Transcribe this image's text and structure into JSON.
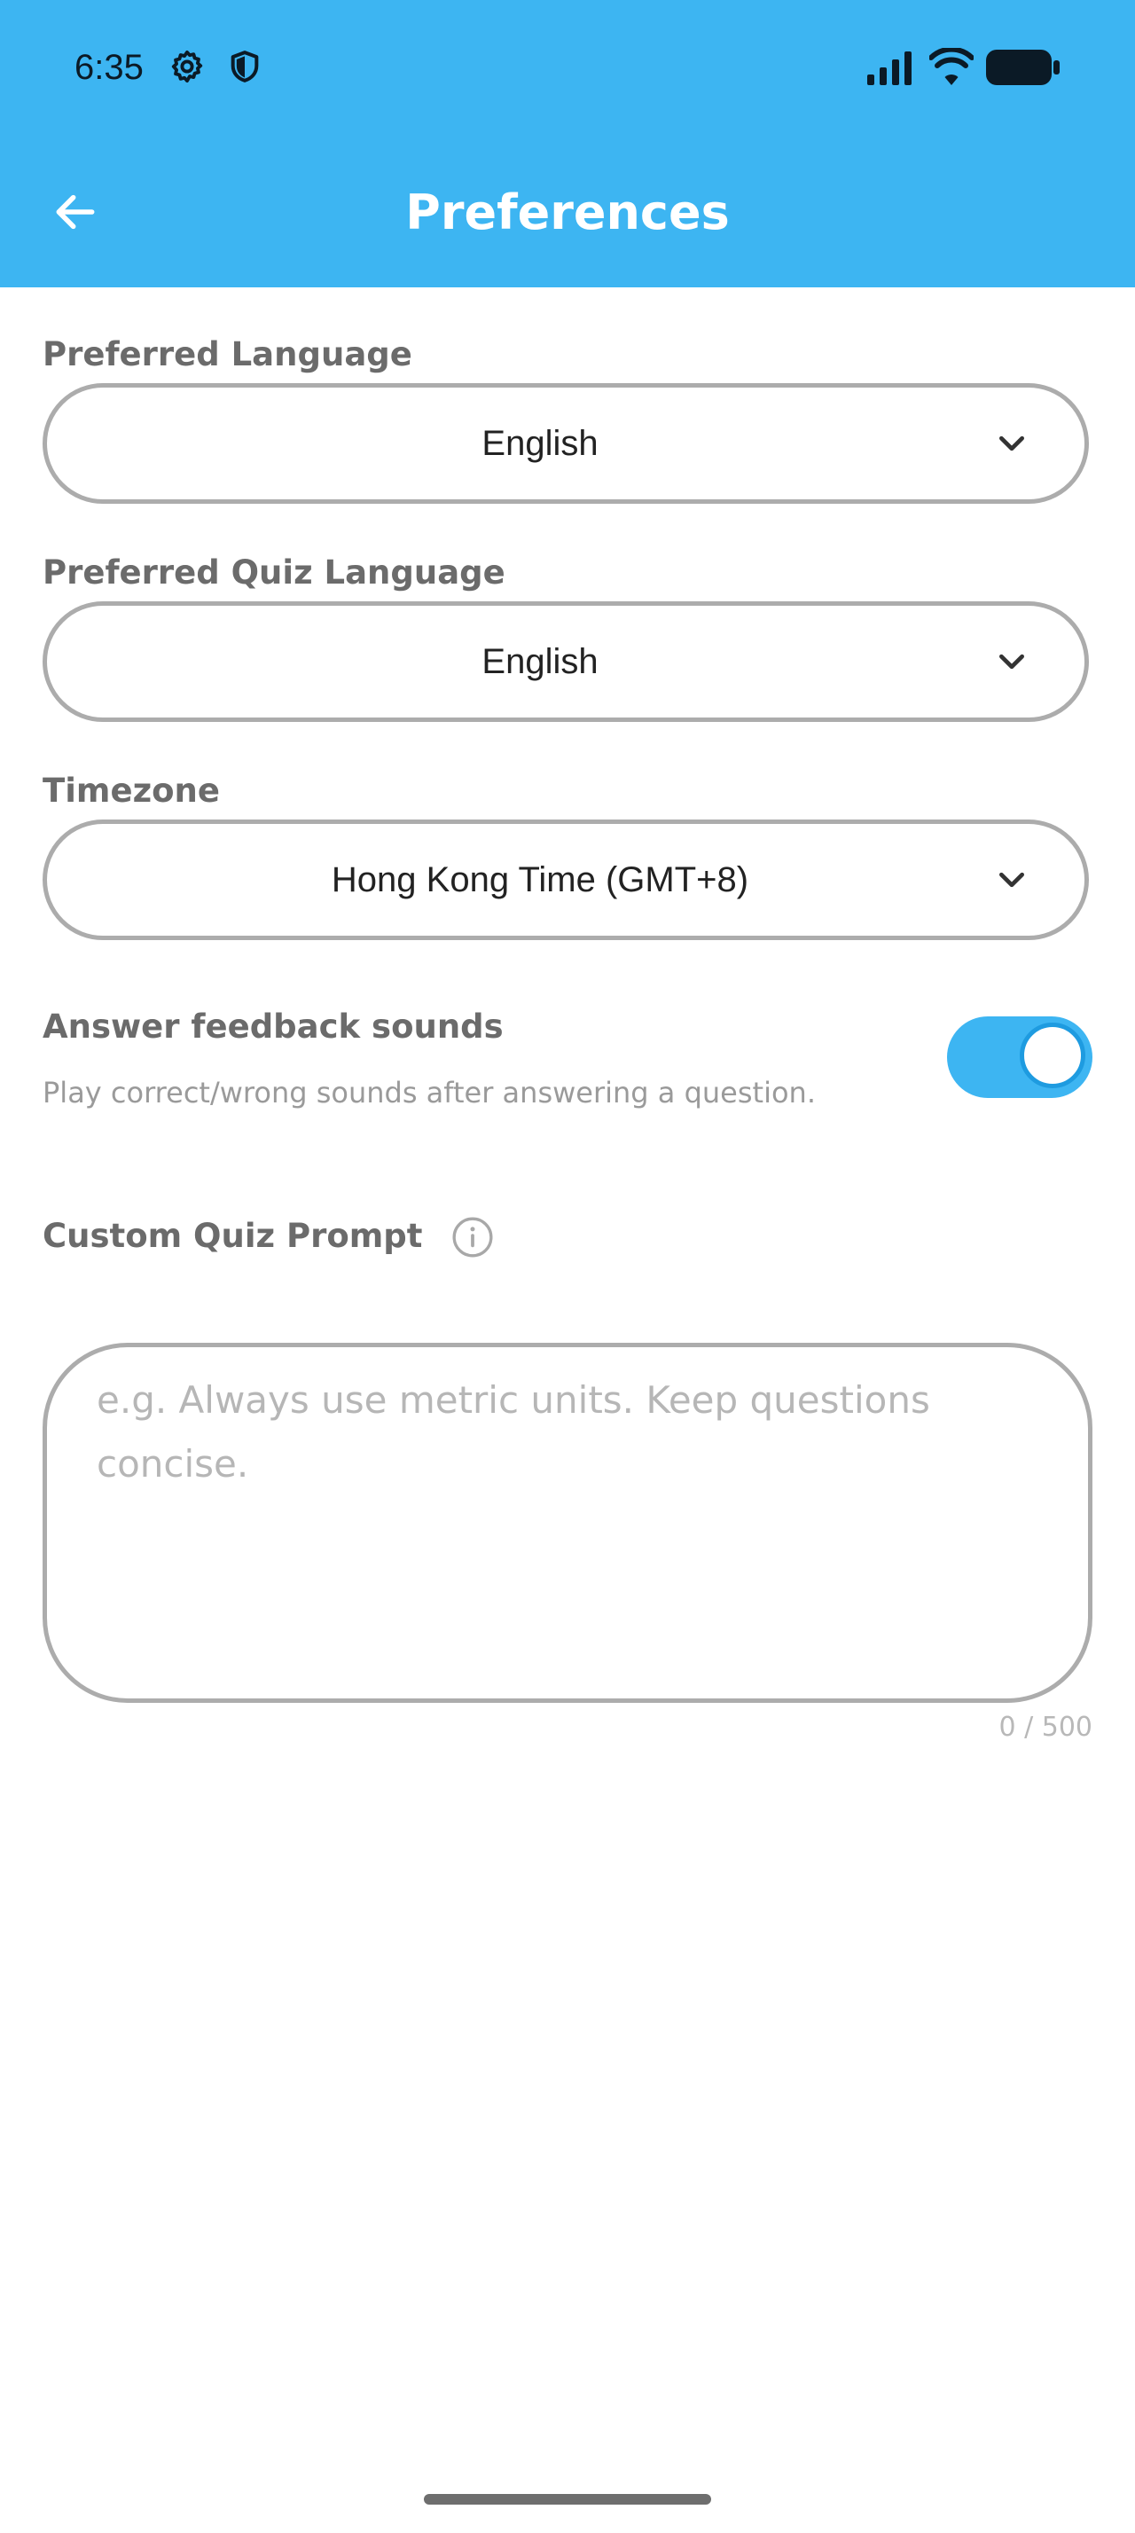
{
  "status_bar": {
    "time": "6:35",
    "icons": [
      "settings-icon",
      "shield-icon",
      "signal-icon",
      "wifi-icon",
      "battery-icon"
    ]
  },
  "app_bar": {
    "title": "Preferences",
    "back_icon": "arrow-left-icon"
  },
  "colors": {
    "accent": "#3db5f2",
    "label": "#6b6b6b",
    "border": "#acacac"
  },
  "preferred_language": {
    "label": "Preferred Language",
    "value": "English"
  },
  "quiz_language": {
    "label": "Preferred Quiz Language",
    "value": "English"
  },
  "timezone": {
    "label": "Timezone",
    "value": "Hong Kong Time (GMT+8)"
  },
  "feedback_sounds": {
    "title": "Answer feedback sounds",
    "description": "Play correct/wrong sounds after answering a question.",
    "enabled": true
  },
  "custom_prompt": {
    "label": "Custom Quiz Prompt",
    "placeholder": "e.g. Always use metric units. Keep questions concise.",
    "value": "",
    "char_count": "0 / 500"
  }
}
